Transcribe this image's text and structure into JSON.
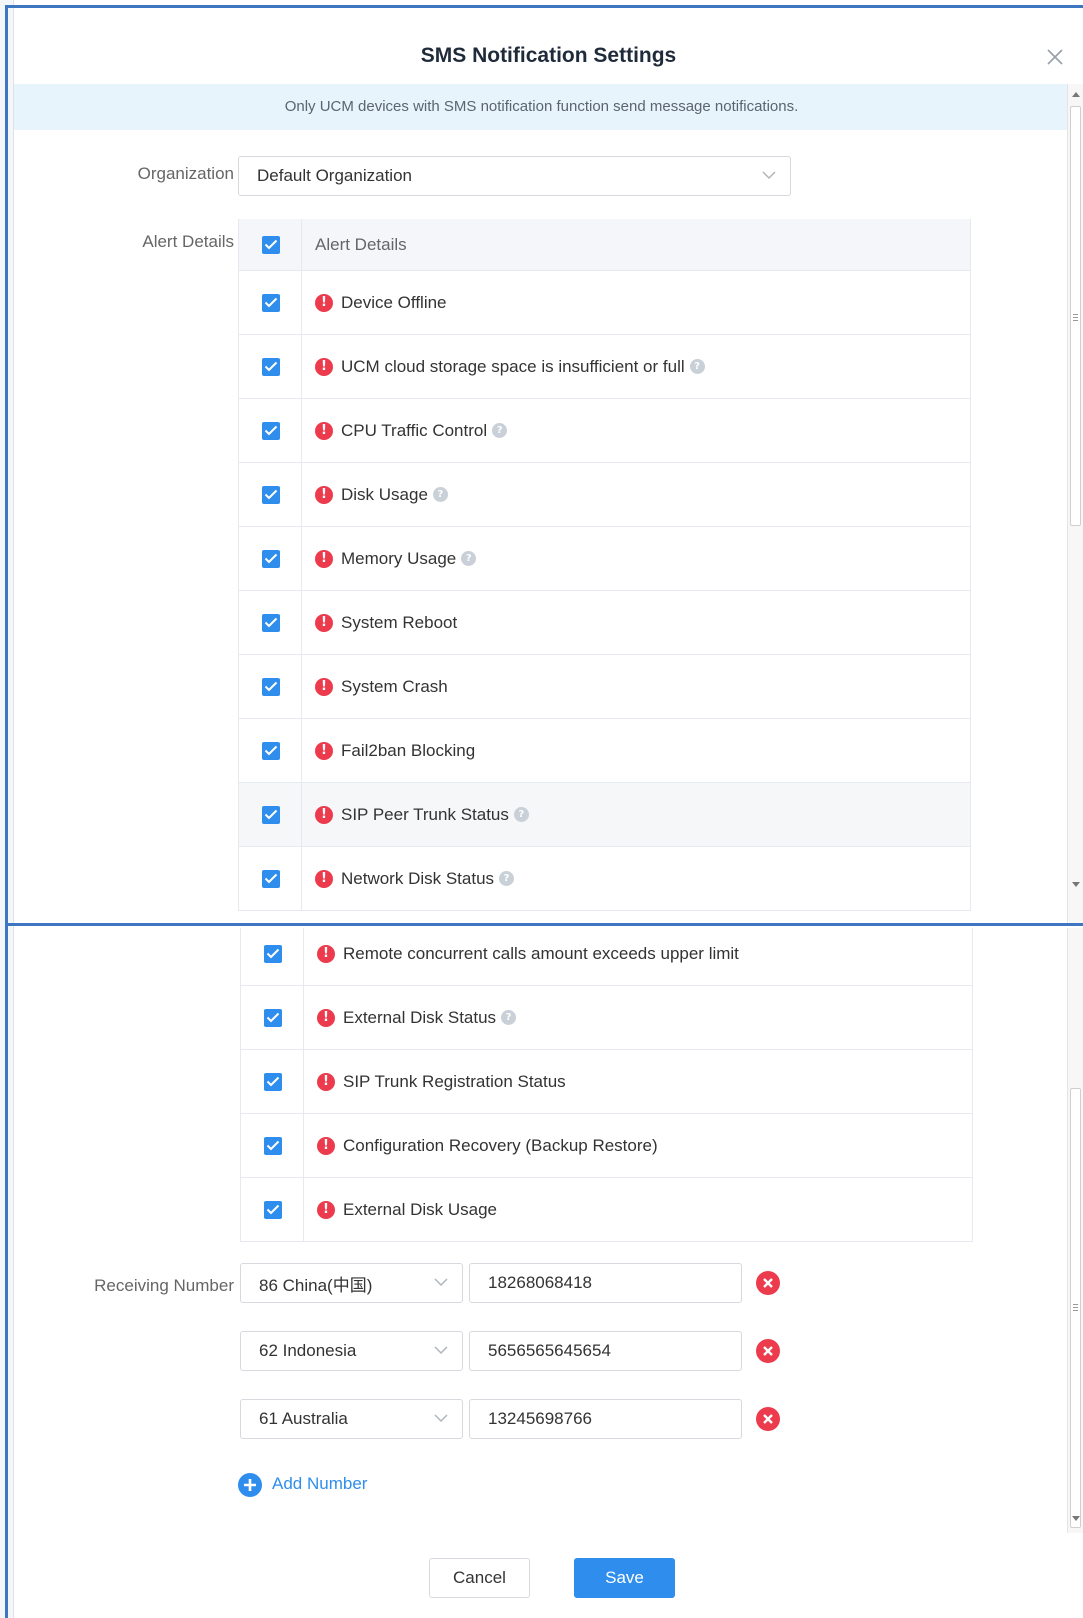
{
  "dialog": {
    "title": "SMS Notification Settings",
    "notice": "Only UCM devices with SMS notification function send message notifications."
  },
  "organization": {
    "label": "Organization",
    "value": "Default Organization"
  },
  "alert_details": {
    "label": "Alert Details",
    "header": "Alert Details",
    "items_top": [
      {
        "label": "Device Offline",
        "help": false,
        "checked": true
      },
      {
        "label": "UCM cloud storage space is insufficient or full",
        "help": true,
        "checked": true
      },
      {
        "label": "CPU Traffic Control",
        "help": true,
        "checked": true
      },
      {
        "label": "Disk Usage",
        "help": true,
        "checked": true
      },
      {
        "label": "Memory Usage",
        "help": true,
        "checked": true
      },
      {
        "label": "System Reboot",
        "help": false,
        "checked": true
      },
      {
        "label": "System Crash",
        "help": false,
        "checked": true
      },
      {
        "label": "Fail2ban Blocking",
        "help": false,
        "checked": true
      },
      {
        "label": "SIP Peer Trunk Status",
        "help": true,
        "checked": true
      },
      {
        "label": "Network Disk Status",
        "help": true,
        "checked": true
      }
    ],
    "items_bottom": [
      {
        "label": "Remote concurrent calls amount exceeds upper limit",
        "help": false,
        "checked": true
      },
      {
        "label": "External Disk Status",
        "help": true,
        "checked": true
      },
      {
        "label": "SIP Trunk Registration Status",
        "help": false,
        "checked": true
      },
      {
        "label": "Configuration Recovery (Backup Restore)",
        "help": false,
        "checked": true
      },
      {
        "label": "External Disk Usage",
        "help": false,
        "checked": true
      }
    ]
  },
  "receiving": {
    "label": "Receiving Number",
    "numbers": [
      {
        "country": "86 China(中国)",
        "number": "18268068418"
      },
      {
        "country": "62 Indonesia",
        "number": "5656565645654"
      },
      {
        "country": "61 Australia",
        "number": "13245698766"
      }
    ],
    "add_label": "Add Number"
  },
  "footer": {
    "cancel": "Cancel",
    "save": "Save"
  },
  "colors": {
    "accent": "#2f8eed",
    "alert": "#ec3b4d",
    "notice_bg": "#e8f4fb"
  }
}
